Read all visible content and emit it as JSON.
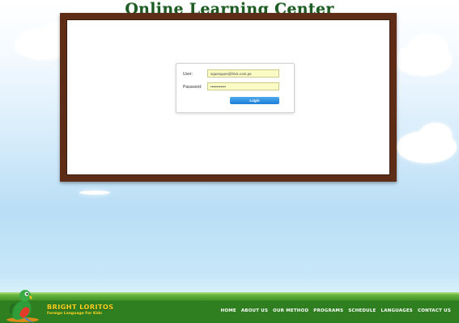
{
  "page": {
    "title": "Online Learning Center"
  },
  "login": {
    "user_label": "User:",
    "password_label": "Password:",
    "user_value": "squesquen@lrick.com.pe",
    "password_value": "••••••••••••",
    "login_button": "Login"
  },
  "footer": {
    "brand_name": "BRIGHT LORITOS",
    "brand_tagline": "Foreign Language For Kids",
    "nav": [
      "HOME",
      "ABOUT US",
      "OUR METHOD",
      "PROGRAMS",
      "SCHEDULE",
      "LANGUAGES",
      "CONTACT US"
    ]
  },
  "colors": {
    "title": "#1f5b25",
    "frame": "#5d2d18",
    "button": "#1c7fd6",
    "field_bg": "#fbfbc6",
    "footer_green": "#2f7f21",
    "brand_yellow": "#ffd21f"
  },
  "icons": {
    "logo": "parrot-logo-icon"
  }
}
